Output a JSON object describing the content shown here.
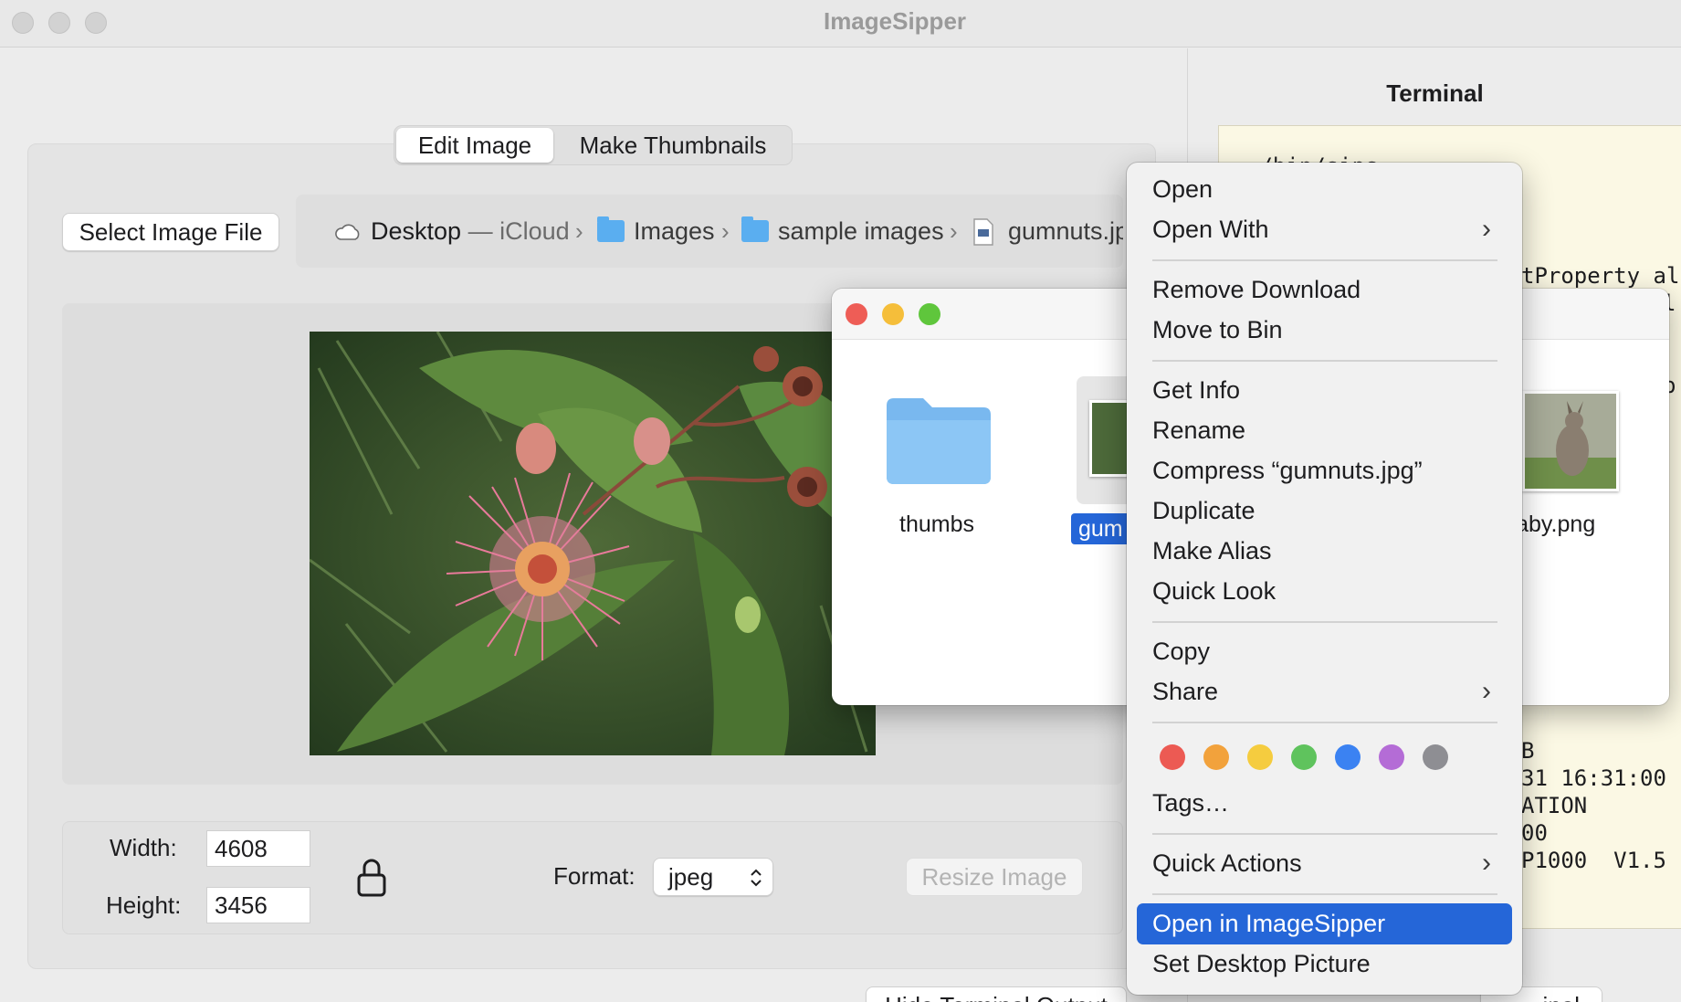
{
  "app": {
    "title": "ImageSipper"
  },
  "tabs": [
    {
      "label": "Edit Image",
      "active": true
    },
    {
      "label": "Make Thumbnails",
      "active": false
    }
  ],
  "toolbar": {
    "select_image_label": "Select Image File"
  },
  "path": {
    "root": "Desktop",
    "root_suffix": "— iCloud",
    "crumbs": [
      "Images",
      "sample images",
      "gumnuts.jp"
    ],
    "separator": "›"
  },
  "size": {
    "width_label": "Width:",
    "width_value": "4608",
    "height_label": "Height:",
    "height_value": "3456"
  },
  "format": {
    "label": "Format:",
    "value": "jpeg"
  },
  "resize_label": "Resize Image",
  "hide_terminal_label": "Hide Terminal Output",
  "terminal_button_partial": "inal",
  "terminal": {
    "title": "Terminal",
    "lines": [
      "~/bin/sips",
      "tProperty al",
      "l",
      "p",
      "B",
      "31 16:31:00",
      "ATION",
      "00",
      "P1000  V1.5"
    ]
  },
  "finder": {
    "items": [
      {
        "name": "thumbs",
        "type": "folder"
      },
      {
        "name": "gum",
        "type": "image",
        "selected": true
      },
      {
        "name": "llaby.png",
        "type": "image"
      }
    ]
  },
  "context_menu": {
    "items": [
      {
        "label": "Open"
      },
      {
        "label": "Open With",
        "submenu": true
      },
      {
        "label": "Remove Download"
      },
      {
        "label": "Move to Bin"
      },
      {
        "label": "Get Info"
      },
      {
        "label": "Rename"
      },
      {
        "label": "Compress “gumnuts.jpg”"
      },
      {
        "label": "Duplicate"
      },
      {
        "label": "Make Alias"
      },
      {
        "label": "Quick Look"
      },
      {
        "label": "Copy"
      },
      {
        "label": "Share",
        "submenu": true
      },
      {
        "label": "Tags…"
      },
      {
        "label": "Quick Actions",
        "submenu": true
      },
      {
        "label": "Open in ImageSipper",
        "highlighted": true
      },
      {
        "label": "Set Desktop Picture"
      }
    ],
    "tag_colors": [
      "#ec5a53",
      "#f2a23c",
      "#f5cc3f",
      "#5fc35d",
      "#3b82f2",
      "#b46cd6",
      "#8e8e93"
    ],
    "highlight_color": "#2566d8"
  }
}
